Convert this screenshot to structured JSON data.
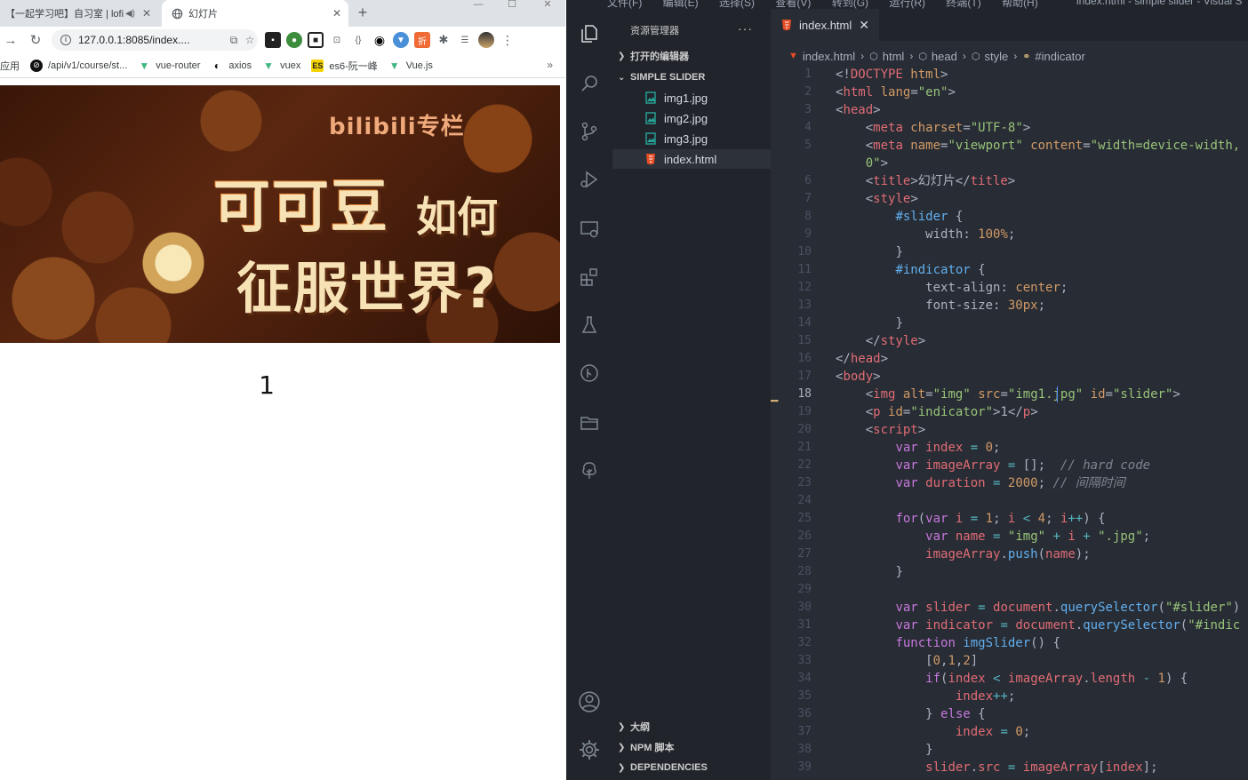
{
  "browser": {
    "tabs": [
      {
        "title": "【一起学习吧】自习室 | lofi",
        "active": false
      },
      {
        "title": "幻灯片",
        "active": true
      }
    ],
    "new_tab": "+",
    "address_url": "127.0.0.1:8085/index....",
    "bookmarks": [
      {
        "label": "应用"
      },
      {
        "label": "/api/v1/course/st..."
      },
      {
        "label": "vue-router"
      },
      {
        "label": "axios"
      },
      {
        "label": "vuex"
      },
      {
        "label": "es6-阮一峰"
      },
      {
        "label": "Vue.js"
      }
    ],
    "bookmarks_more": "»",
    "page": {
      "slide_brand": "bilibili专栏",
      "slide_headline_1": "可可豆",
      "slide_headline_1b": "如何",
      "slide_headline_2": "征服世界?",
      "indicator": "1"
    }
  },
  "vscode": {
    "menu": [
      "文件(F)",
      "编辑(E)",
      "选择(S)",
      "查看(V)",
      "转到(G)",
      "运行(R)",
      "终端(T)",
      "帮助(H)"
    ],
    "window_title": "index.html - simple slider - Visual S",
    "explorer": {
      "title": "资源管理器",
      "more": "···",
      "open_editors": "打开的编辑器",
      "project": "SIMPLE SLIDER",
      "files": [
        "img1.jpg",
        "img2.jpg",
        "img3.jpg",
        "index.html"
      ],
      "selected_file": "index.html",
      "outline": "大纲",
      "npm": "NPM 脚本",
      "dependencies": "DEPENDENCIES"
    },
    "editor": {
      "tab": "index.html",
      "breadcrumbs": [
        "index.html",
        "html",
        "head",
        "style",
        "#indicator"
      ],
      "current_line": 18,
      "lines": [
        [
          [
            "tk-punc",
            "<!"
          ],
          [
            "tk-tag",
            "DOCTYPE"
          ],
          [
            "tk-attr",
            " html"
          ],
          [
            "tk-punc",
            ">"
          ]
        ],
        [
          [
            "tk-punc",
            "<"
          ],
          [
            "tk-tag",
            "html"
          ],
          [
            "tk-attr",
            " lang"
          ],
          [
            "tk-punc",
            "="
          ],
          [
            "tk-str",
            "\"en\""
          ],
          [
            "tk-punc",
            ">"
          ]
        ],
        [
          [
            "tk-punc",
            "<"
          ],
          [
            "tk-tag",
            "head"
          ],
          [
            "tk-punc",
            ">"
          ]
        ],
        [
          [
            "tk-plain",
            "    "
          ],
          [
            "tk-punc",
            "<"
          ],
          [
            "tk-tag",
            "meta"
          ],
          [
            "tk-attr",
            " charset"
          ],
          [
            "tk-punc",
            "="
          ],
          [
            "tk-str",
            "\"UTF-8\""
          ],
          [
            "tk-punc",
            ">"
          ]
        ],
        [
          [
            "tk-plain",
            "    "
          ],
          [
            "tk-punc",
            "<"
          ],
          [
            "tk-tag",
            "meta"
          ],
          [
            "tk-attr",
            " name"
          ],
          [
            "tk-punc",
            "="
          ],
          [
            "tk-str",
            "\"viewport\""
          ],
          [
            "tk-attr",
            " content"
          ],
          [
            "tk-punc",
            "="
          ],
          [
            "tk-str",
            "\"width=device-width,"
          ]
        ],
        [
          [
            "tk-str",
            "    0\""
          ],
          [
            "tk-punc",
            ">"
          ]
        ],
        [
          [
            "tk-plain",
            "    "
          ],
          [
            "tk-punc",
            "<"
          ],
          [
            "tk-tag",
            "title"
          ],
          [
            "tk-punc",
            ">"
          ],
          [
            "tk-plain",
            "幻灯片"
          ],
          [
            "tk-punc",
            "</"
          ],
          [
            "tk-tag",
            "title"
          ],
          [
            "tk-punc",
            ">"
          ]
        ],
        [
          [
            "tk-plain",
            "    "
          ],
          [
            "tk-punc",
            "<"
          ],
          [
            "tk-tag",
            "style"
          ],
          [
            "tk-punc",
            ">"
          ]
        ],
        [
          [
            "tk-plain",
            "        "
          ],
          [
            "tk-sel",
            "#slider"
          ],
          [
            "tk-punc",
            " {"
          ]
        ],
        [
          [
            "tk-plain",
            "            "
          ],
          [
            "tk-prop",
            "width"
          ],
          [
            "tk-punc",
            ": "
          ],
          [
            "tk-num",
            "100%"
          ],
          [
            "tk-punc",
            ";"
          ]
        ],
        [
          [
            "tk-plain",
            "        "
          ],
          [
            "tk-punc",
            "}"
          ]
        ],
        [
          [
            "tk-plain",
            "        "
          ],
          [
            "tk-sel",
            "#indicator"
          ],
          [
            "tk-punc",
            " {"
          ]
        ],
        [
          [
            "tk-plain",
            "            "
          ],
          [
            "tk-prop",
            "text-align"
          ],
          [
            "tk-punc",
            ": "
          ],
          [
            "tk-num",
            "center"
          ],
          [
            "tk-punc",
            ";"
          ]
        ],
        [
          [
            "tk-plain",
            "            "
          ],
          [
            "tk-prop",
            "font-size"
          ],
          [
            "tk-punc",
            ": "
          ],
          [
            "tk-num",
            "30px"
          ],
          [
            "tk-punc",
            ";"
          ]
        ],
        [
          [
            "tk-plain",
            "        "
          ],
          [
            "tk-punc",
            "}"
          ]
        ],
        [
          [
            "tk-plain",
            "    "
          ],
          [
            "tk-punc",
            "</"
          ],
          [
            "tk-tag",
            "style"
          ],
          [
            "tk-punc",
            ">"
          ]
        ],
        [
          [
            "tk-punc",
            "</"
          ],
          [
            "tk-tag",
            "head"
          ],
          [
            "tk-punc",
            ">"
          ]
        ],
        [
          [
            "tk-punc",
            "<"
          ],
          [
            "tk-tag",
            "body"
          ],
          [
            "tk-punc",
            ">"
          ]
        ],
        [
          [
            "tk-plain",
            "    "
          ],
          [
            "tk-punc",
            "<"
          ],
          [
            "tk-tag",
            "img"
          ],
          [
            "tk-attr",
            " alt"
          ],
          [
            "tk-punc",
            "="
          ],
          [
            "tk-str",
            "\"img\""
          ],
          [
            "tk-attr",
            " src"
          ],
          [
            "tk-punc",
            "="
          ],
          [
            "tk-str",
            "\"img1.jpg\""
          ],
          [
            "tk-attr",
            " id"
          ],
          [
            "tk-punc",
            "="
          ],
          [
            "tk-str",
            "\"slider\""
          ],
          [
            "tk-punc",
            ">"
          ]
        ],
        [
          [
            "tk-plain",
            "    "
          ],
          [
            "tk-punc",
            "<"
          ],
          [
            "tk-tag",
            "p"
          ],
          [
            "tk-attr",
            " id"
          ],
          [
            "tk-punc",
            "="
          ],
          [
            "tk-str",
            "\"indicator\""
          ],
          [
            "tk-punc",
            ">"
          ],
          [
            "tk-plain",
            "1"
          ],
          [
            "tk-punc",
            "</"
          ],
          [
            "tk-tag",
            "p"
          ],
          [
            "tk-punc",
            ">"
          ]
        ],
        [
          [
            "tk-plain",
            "    "
          ],
          [
            "tk-punc",
            "<"
          ],
          [
            "tk-tag",
            "script"
          ],
          [
            "tk-punc",
            ">"
          ]
        ],
        [
          [
            "tk-plain",
            "        "
          ],
          [
            "tk-kw",
            "var"
          ],
          [
            "tk-var",
            " index"
          ],
          [
            "tk-cyan",
            " = "
          ],
          [
            "tk-num",
            "0"
          ],
          [
            "tk-punc",
            ";"
          ]
        ],
        [
          [
            "tk-plain",
            "        "
          ],
          [
            "tk-kw",
            "var"
          ],
          [
            "tk-var",
            " imageArray"
          ],
          [
            "tk-cyan",
            " = "
          ],
          [
            "tk-punc",
            "[];  "
          ],
          [
            "tk-com",
            "// hard code"
          ]
        ],
        [
          [
            "tk-plain",
            "        "
          ],
          [
            "tk-kw",
            "var"
          ],
          [
            "tk-var",
            " duration"
          ],
          [
            "tk-cyan",
            " = "
          ],
          [
            "tk-num",
            "2000"
          ],
          [
            "tk-punc",
            "; "
          ],
          [
            "tk-com",
            "// 间隔时间"
          ]
        ],
        [],
        [
          [
            "tk-plain",
            "        "
          ],
          [
            "tk-kw",
            "for"
          ],
          [
            "tk-punc",
            "("
          ],
          [
            "tk-kw",
            "var"
          ],
          [
            "tk-var",
            " i"
          ],
          [
            "tk-cyan",
            " = "
          ],
          [
            "tk-num",
            "1"
          ],
          [
            "tk-punc",
            "; "
          ],
          [
            "tk-var",
            "i"
          ],
          [
            "tk-cyan",
            " < "
          ],
          [
            "tk-num",
            "4"
          ],
          [
            "tk-punc",
            "; "
          ],
          [
            "tk-var",
            "i"
          ],
          [
            "tk-cyan",
            "++"
          ],
          [
            "tk-punc",
            ") {"
          ]
        ],
        [
          [
            "tk-plain",
            "            "
          ],
          [
            "tk-kw",
            "var"
          ],
          [
            "tk-var",
            " name"
          ],
          [
            "tk-cyan",
            " = "
          ],
          [
            "tk-str",
            "\"img\""
          ],
          [
            "tk-cyan",
            " + "
          ],
          [
            "tk-var",
            "i"
          ],
          [
            "tk-cyan",
            " + "
          ],
          [
            "tk-str",
            "\".jpg\""
          ],
          [
            "tk-punc",
            ";"
          ]
        ],
        [
          [
            "tk-plain",
            "            "
          ],
          [
            "tk-var",
            "imageArray"
          ],
          [
            "tk-punc",
            "."
          ],
          [
            "tk-fn",
            "push"
          ],
          [
            "tk-punc",
            "("
          ],
          [
            "tk-var",
            "name"
          ],
          [
            "tk-punc",
            ");"
          ]
        ],
        [
          [
            "tk-plain",
            "        "
          ],
          [
            "tk-punc",
            "}"
          ]
        ],
        [],
        [
          [
            "tk-plain",
            "        "
          ],
          [
            "tk-kw",
            "var"
          ],
          [
            "tk-var",
            " slider"
          ],
          [
            "tk-cyan",
            " = "
          ],
          [
            "tk-var",
            "document"
          ],
          [
            "tk-punc",
            "."
          ],
          [
            "tk-fn",
            "querySelector"
          ],
          [
            "tk-punc",
            "("
          ],
          [
            "tk-str",
            "\"#slider\""
          ],
          [
            "tk-punc",
            ")"
          ]
        ],
        [
          [
            "tk-plain",
            "        "
          ],
          [
            "tk-kw",
            "var"
          ],
          [
            "tk-var",
            " indicator"
          ],
          [
            "tk-cyan",
            " = "
          ],
          [
            "tk-var",
            "document"
          ],
          [
            "tk-punc",
            "."
          ],
          [
            "tk-fn",
            "querySelector"
          ],
          [
            "tk-punc",
            "("
          ],
          [
            "tk-str",
            "\"#indic"
          ]
        ],
        [
          [
            "tk-plain",
            "        "
          ],
          [
            "tk-kw",
            "function"
          ],
          [
            "tk-fn",
            " imgSlider"
          ],
          [
            "tk-punc",
            "() {"
          ]
        ],
        [
          [
            "tk-plain",
            "            "
          ],
          [
            "tk-punc",
            "["
          ],
          [
            "tk-num",
            "0"
          ],
          [
            "tk-punc",
            ","
          ],
          [
            "tk-num",
            "1"
          ],
          [
            "tk-punc",
            ","
          ],
          [
            "tk-num",
            "2"
          ],
          [
            "tk-punc",
            "]"
          ]
        ],
        [
          [
            "tk-plain",
            "            "
          ],
          [
            "tk-kw",
            "if"
          ],
          [
            "tk-punc",
            "("
          ],
          [
            "tk-var",
            "index"
          ],
          [
            "tk-cyan",
            " < "
          ],
          [
            "tk-var",
            "imageArray"
          ],
          [
            "tk-punc",
            "."
          ],
          [
            "tk-var",
            "length"
          ],
          [
            "tk-cyan",
            " - "
          ],
          [
            "tk-num",
            "1"
          ],
          [
            "tk-punc",
            ") {"
          ]
        ],
        [
          [
            "tk-plain",
            "                "
          ],
          [
            "tk-var",
            "index"
          ],
          [
            "tk-cyan",
            "++"
          ],
          [
            "tk-punc",
            ";"
          ]
        ],
        [
          [
            "tk-plain",
            "            "
          ],
          [
            "tk-punc",
            "} "
          ],
          [
            "tk-kw",
            "else"
          ],
          [
            "tk-punc",
            " {"
          ]
        ],
        [
          [
            "tk-plain",
            "                "
          ],
          [
            "tk-var",
            "index"
          ],
          [
            "tk-cyan",
            " = "
          ],
          [
            "tk-num",
            "0"
          ],
          [
            "tk-punc",
            ";"
          ]
        ],
        [
          [
            "tk-plain",
            "            "
          ],
          [
            "tk-punc",
            "}"
          ]
        ],
        [
          [
            "tk-plain",
            "            "
          ],
          [
            "tk-var",
            "slider"
          ],
          [
            "tk-punc",
            "."
          ],
          [
            "tk-var",
            "src"
          ],
          [
            "tk-cyan",
            " = "
          ],
          [
            "tk-var",
            "imageArray"
          ],
          [
            "tk-punc",
            "["
          ],
          [
            "tk-var",
            "index"
          ],
          [
            "tk-punc",
            "];"
          ]
        ]
      ],
      "line_numbers": [
        "1",
        "2",
        "3",
        "4",
        "5",
        "",
        "6",
        "7",
        "8",
        "9",
        "10",
        "11",
        "12",
        "13",
        "14",
        "15",
        "16",
        "17",
        "18",
        "19",
        "20",
        "21",
        "22",
        "23",
        "24",
        "25",
        "26",
        "27",
        "28",
        "29",
        "30",
        "31",
        "32",
        "33",
        "34",
        "35",
        "36",
        "37",
        "38",
        "39"
      ]
    }
  }
}
